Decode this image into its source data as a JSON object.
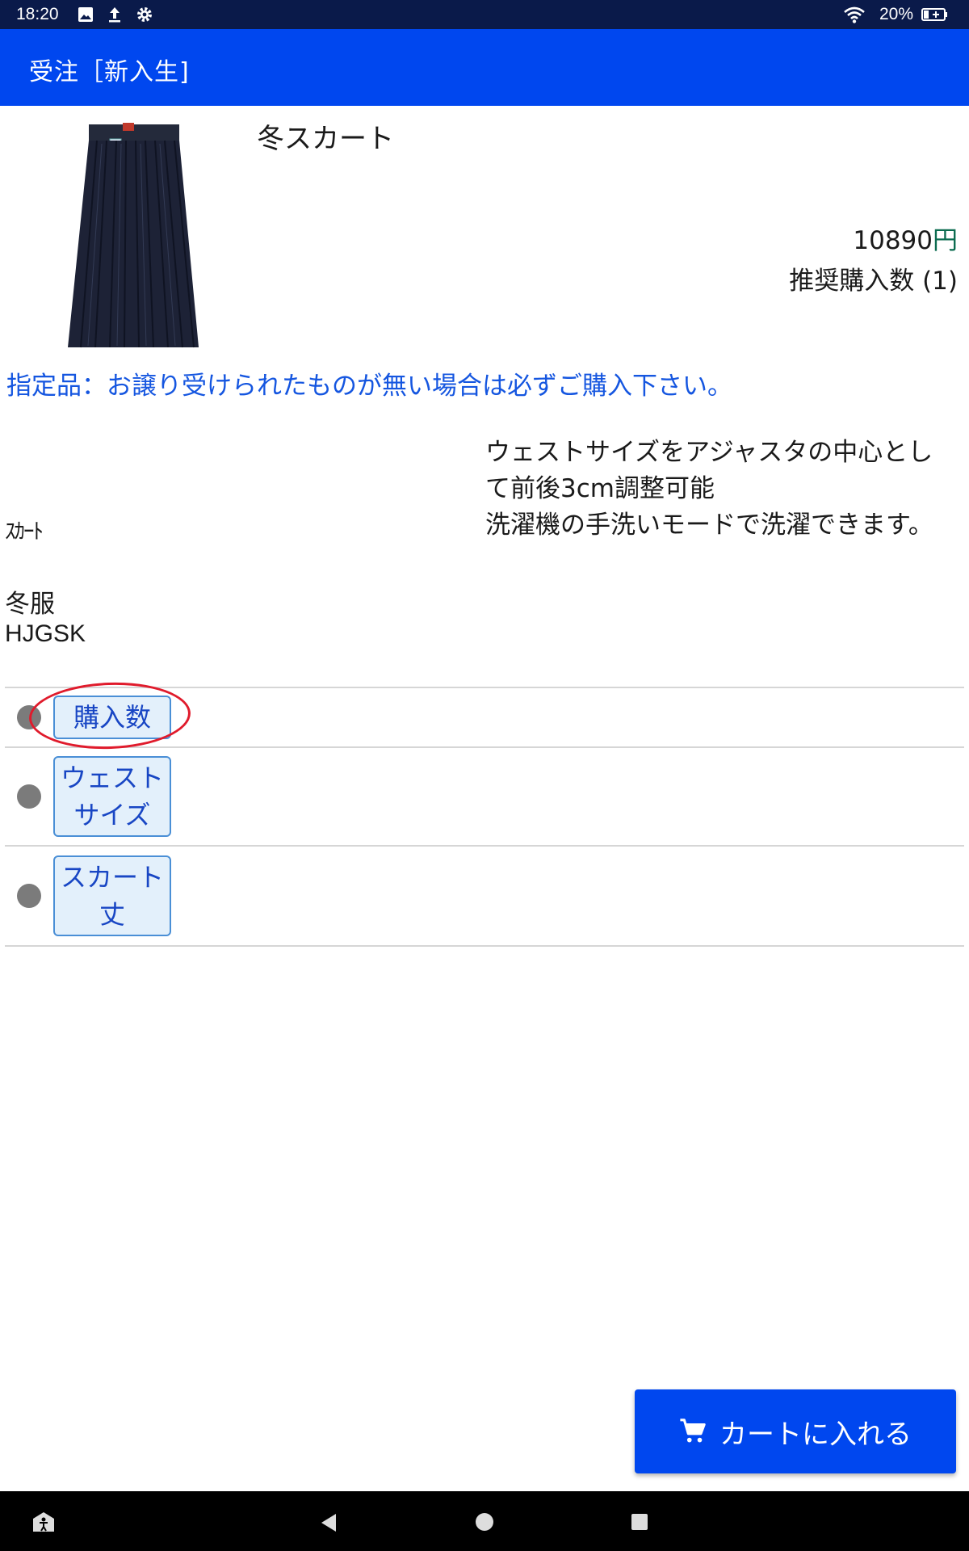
{
  "status_bar": {
    "time": "18:20",
    "battery_percent": "20%",
    "icons": [
      "image-icon",
      "upload-icon",
      "settings-icon",
      "wifi-icon",
      "battery-icon"
    ]
  },
  "app_bar": {
    "title": "受注［新入生]"
  },
  "product": {
    "name": "冬スカート",
    "price": "10890",
    "currency": "円",
    "recommended": "推奨購入数 (1)",
    "notice": "指定品：お譲り受けられたものが無い場合は必ずご購入下さい。",
    "description": [
      "ウェストサイズをアジャスタの中心とし",
      "て前後3cm調整可能",
      "洗濯機の手洗いモードで洗濯できます。"
    ],
    "category": "ｽｶｰﾄ",
    "season": "冬服",
    "code": "HJGSK"
  },
  "options": [
    {
      "lines": [
        "購入数"
      ]
    },
    {
      "lines": [
        "ウェスト",
        "サイズ"
      ]
    },
    {
      "lines": [
        "スカート",
        "丈"
      ]
    }
  ],
  "cart_button": {
    "label": "カートに入れる",
    "icon": "cart-icon"
  },
  "nav_bar": {
    "icons": [
      "accessibility-icon",
      "back-icon",
      "home-icon",
      "recents-icon"
    ]
  },
  "colors": {
    "primary": "#0047ef",
    "status_bar": "#0a1a4a",
    "notice_text": "#1556e0",
    "highlight_circle": "#e01b2c",
    "yen": "#0b6b4f"
  }
}
